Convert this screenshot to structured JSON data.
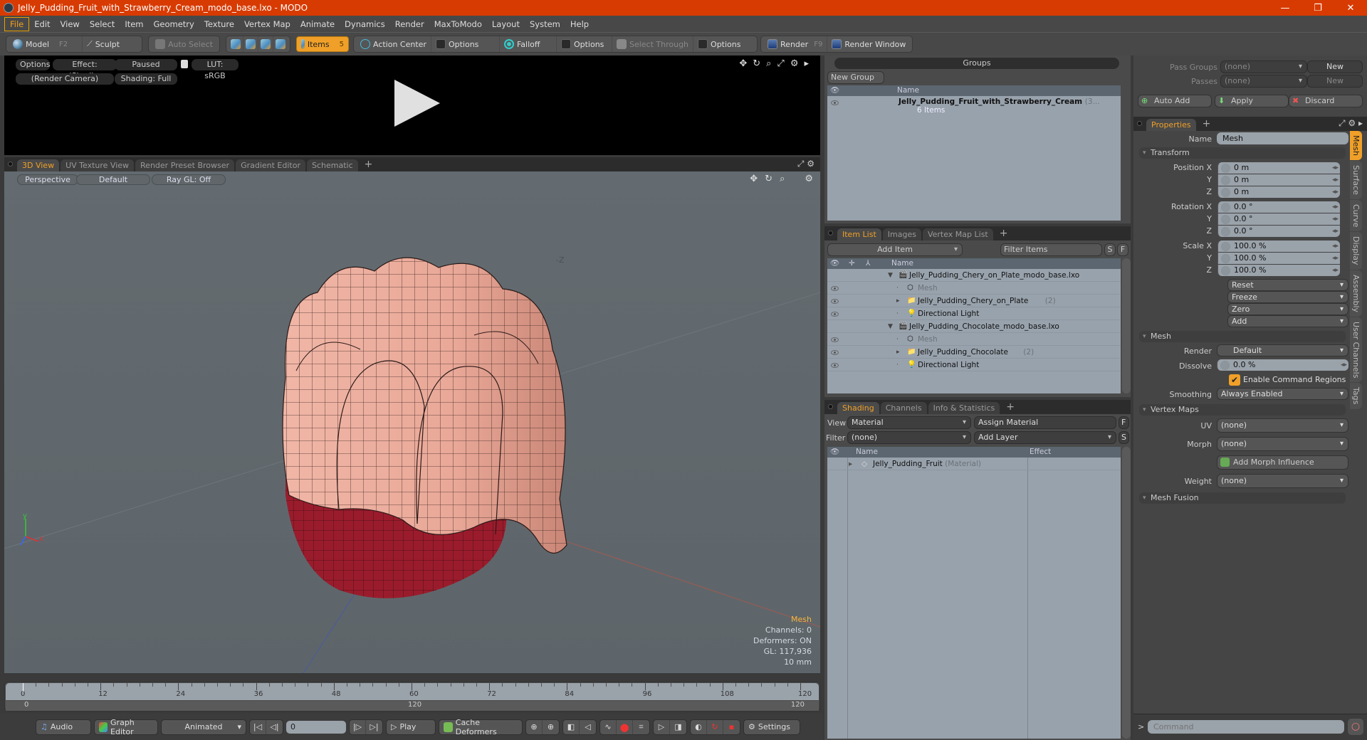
{
  "window": {
    "title": "Jelly_Pudding_Fruit_with_Strawberry_Cream_modo_base.lxo - MODO",
    "controls": [
      "minimize",
      "restore",
      "close"
    ]
  },
  "menubar": [
    "File",
    "Edit",
    "View",
    "Select",
    "Item",
    "Geometry",
    "Texture",
    "Vertex Map",
    "Animate",
    "Dynamics",
    "Render",
    "MaxToModo",
    "Layout",
    "System",
    "Help"
  ],
  "toolbar": {
    "model": "Model",
    "model_key": "F2",
    "sculpt": "Sculpt",
    "auto_select": "Auto Select",
    "items": "Items",
    "items_key": "5",
    "action_center": "Action Center",
    "options1": "Options",
    "falloff": "Falloff",
    "options2": "Options",
    "select_through": "Select Through",
    "options3": "Options",
    "render": "Render",
    "render_key": "F9",
    "render_window": "Render Window"
  },
  "preview": {
    "options": "Options",
    "effect": "Effect: (Shadi...",
    "paused": "Paused",
    "lut": "LUT: sRGB",
    "camera": "(Render Camera)",
    "shading": "Shading: Full"
  },
  "viewport_tabs": [
    "3D View",
    "UV Texture View",
    "Render Preset Browser",
    "Gradient Editor",
    "Schematic"
  ],
  "viewport": {
    "projection": "Perspective",
    "style": "Default",
    "raygl": "Ray GL: Off",
    "axis_label": "-Z",
    "hud": {
      "selection": "Mesh",
      "channels": "Channels: 0",
      "deformers": "Deformers: ON",
      "gl": "GL: 117,936",
      "unit": "10 mm"
    }
  },
  "timeline": {
    "ticks": [
      0,
      12,
      24,
      36,
      48,
      60,
      72,
      84,
      96,
      108,
      120
    ],
    "range_start": "0",
    "range_mid": "120",
    "range_end": "120"
  },
  "transport": {
    "audio": "Audio",
    "graph_editor": "Graph Editor",
    "mode": "Animated",
    "frame": "0",
    "play": "Play",
    "cache_deformers": "Cache Deformers",
    "settings": "Settings"
  },
  "groups": {
    "title": "Groups",
    "new_group": "New Group",
    "col_name": "Name",
    "items": [
      {
        "name": "Jelly_Pudding_Fruit_with_Strawberry_Cream",
        "suffix": "(3...",
        "sub": "6 Items"
      }
    ]
  },
  "item_list": {
    "tabs": [
      "Item List",
      "Images",
      "Vertex Map List"
    ],
    "add_item": "Add Item",
    "filter": "Filter Items",
    "btn_s": "S",
    "btn_f": "F",
    "col_name": "Name",
    "rows": [
      {
        "name": "Jelly_Pudding_Chery_on_Plate_modo_base.lxo",
        "type": "scene",
        "level": 0,
        "count": ""
      },
      {
        "name": "Mesh",
        "type": "mesh",
        "level": 1,
        "count": ""
      },
      {
        "name": "Jelly_Pudding_Chery_on_Plate",
        "type": "group",
        "level": 1,
        "count": "(2)"
      },
      {
        "name": "Directional Light",
        "type": "light",
        "level": 1,
        "count": ""
      },
      {
        "name": "Jelly_Pudding_Chocolate_modo_base.lxo",
        "type": "scene",
        "level": 0,
        "count": ""
      },
      {
        "name": "Mesh",
        "type": "mesh",
        "level": 1,
        "count": ""
      },
      {
        "name": "Jelly_Pudding_Chocolate",
        "type": "group",
        "level": 1,
        "count": "(2)"
      },
      {
        "name": "Directional Light",
        "type": "light",
        "level": 1,
        "count": ""
      }
    ]
  },
  "shading": {
    "tabs": [
      "Shading",
      "Channels",
      "Info & Statistics"
    ],
    "view_label": "View",
    "view_value": "Material",
    "assign_material": "Assign Material",
    "btn_f": "F",
    "filter_label": "Filter",
    "filter_value": "(none)",
    "add_layer": "Add Layer",
    "btn_s": "S",
    "col_name": "Name",
    "col_effect": "Effect",
    "rows": [
      {
        "name": "Jelly_Pudding_Fruit",
        "suffix": "(Material)"
      }
    ]
  },
  "passes": {
    "pass_groups_label": "Pass Groups",
    "pass_groups_value": "(none)",
    "new1": "New",
    "passes_label": "Passes",
    "passes_value": "(none)",
    "new2": "New",
    "auto_add": "Auto Add",
    "apply": "Apply",
    "discard": "Discard"
  },
  "properties": {
    "tab": "Properties",
    "name_label": "Name",
    "name_value": "Mesh",
    "transform": "Transform",
    "position": {
      "label": "Position X",
      "x": "0 m",
      "y": "0 m",
      "z": "0 m"
    },
    "rotation": {
      "label": "Rotation X",
      "x": "0.0 °",
      "y": "0.0 °",
      "z": "0.0 °"
    },
    "scale": {
      "label": "Scale X",
      "x": "100.0 %",
      "y": "100.0 %",
      "z": "100.0 %"
    },
    "axis_y": "Y",
    "axis_z": "Z",
    "actions": [
      "Reset",
      "Freeze",
      "Zero",
      "Add"
    ],
    "mesh_section": "Mesh",
    "render_label": "Render",
    "render_value": "Default",
    "dissolve_label": "Dissolve",
    "dissolve_value": "0.0 %",
    "enable_cmd_regions": "Enable Command Regions",
    "enable_cmd_regions_checked": true,
    "smoothing_label": "Smoothing",
    "smoothing_value": "Always Enabled",
    "vertex_maps": "Vertex Maps",
    "uv_label": "UV",
    "uv_value": "(none)",
    "morph_label": "Morph",
    "morph_value": "(none)",
    "add_morph": "Add Morph Influence",
    "weight_label": "Weight",
    "weight_value": "(none)",
    "mesh_fusion": "Mesh Fusion",
    "side_tabs": [
      "Mesh",
      "Surface",
      "Curve",
      "Display",
      "Assembly",
      "User Channels",
      "Tags"
    ]
  },
  "command": {
    "prompt": ">",
    "placeholder": "Command"
  },
  "colors": {
    "accent": "#f0a028",
    "titlebar": "#d83b01",
    "jelly_cream": "#e8a898",
    "jelly_red": "#9a1c2c"
  }
}
